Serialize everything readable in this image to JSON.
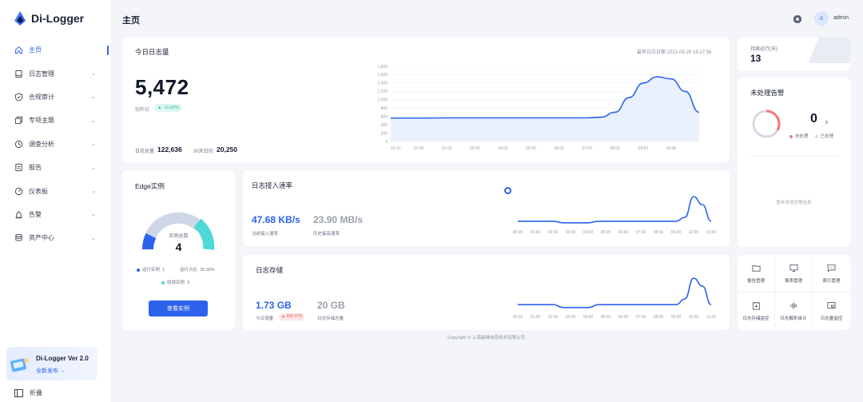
{
  "app": {
    "name": "Di-Logger",
    "page_title": "主页",
    "user": "admin",
    "avatar_letter": "A"
  },
  "sidebar": {
    "items": [
      {
        "label": "主页",
        "icon": "home-icon",
        "active": true,
        "expandable": false
      },
      {
        "label": "日志管理",
        "icon": "log-icon",
        "expandable": true
      },
      {
        "label": "合规审计",
        "icon": "shield-icon",
        "expandable": true
      },
      {
        "label": "专项主题",
        "icon": "topic-icon",
        "expandable": true
      },
      {
        "label": "调查分析",
        "icon": "analysis-icon",
        "expandable": true
      },
      {
        "label": "报告",
        "icon": "report-icon",
        "expandable": true
      },
      {
        "label": "仪表板",
        "icon": "dashboard-icon",
        "expandable": true
      },
      {
        "label": "告警",
        "icon": "alarm-icon",
        "expandable": true
      },
      {
        "label": "资产中心",
        "icon": "database-icon",
        "expandable": true
      }
    ],
    "promo": {
      "version": "Di-Logger Ver 2.0",
      "link": "全新发布 →"
    },
    "collapse": "折叠"
  },
  "today_logs": {
    "title": "今日日志量",
    "updated": "最早日志日期 2021-09-29 18:27:58",
    "value": "5,472",
    "compare_label": "较昨日",
    "compare_change": "▲ -11.62%",
    "total_label": "日志总量",
    "total_value": "122,636",
    "avg_label": "30天日均",
    "avg_value": "20,250"
  },
  "uptime": {
    "label": "持续运行(天)",
    "value": "13"
  },
  "alarms": {
    "title": "未处理告警",
    "count": "0",
    "unit": "条",
    "legend": [
      "未处理",
      "已处理"
    ],
    "empty": "暂未发现告警信息",
    "colors": {
      "unprocessed": "#ef7b7b",
      "processed": "#d5d9e2"
    }
  },
  "edge": {
    "title": "Edge实例",
    "gauge_label": "实例总数",
    "gauge_value": "4",
    "running_label": "运行实例",
    "running_value": "1",
    "ratio_label": "运行占比",
    "ratio_value": "25.00%",
    "pending_label": "收敛实例",
    "pending_value": "3",
    "button": "查看实例",
    "colors": {
      "running": "#2d62ed",
      "pending": "#4fd9d6",
      "rest": "#cfd6e6"
    }
  },
  "rate": {
    "title": "日志接入速率",
    "current_value": "47.68 KB/s",
    "current_label": "当前接入速率",
    "peak_value": "23.90 MB/s",
    "peak_label": "历史最高速率"
  },
  "storage": {
    "title": "日志存储",
    "today_value": "1.73 GB",
    "today_label": "今日增量",
    "today_change": "▲ 499.37%",
    "total_value": "20 GB",
    "total_label": "日志存储总量"
  },
  "quick_links": [
    {
      "label": "报告管理",
      "icon": "folder-icon"
    },
    {
      "label": "报表管理",
      "icon": "monitor-icon"
    },
    {
      "label": "索引管理",
      "icon": "message-icon"
    },
    {
      "label": "日志存储监控",
      "icon": "storage-monitor-icon"
    },
    {
      "label": "日志解析审计",
      "icon": "waveform-icon"
    },
    {
      "label": "日志量监控",
      "icon": "volume-monitor-icon"
    }
  ],
  "footer": "Copyright © 上海晨维信息技术有限公司",
  "chart_data": [
    {
      "type": "area",
      "name": "today_logs",
      "y_ticks": [
        "1,800",
        "1,600",
        "1,400",
        "1,200",
        "1,000",
        "800",
        "600",
        "400",
        "200",
        "0"
      ],
      "x_ticks": [
        "10-11",
        "01:00",
        "02:00",
        "03:00",
        "04:00",
        "05:00",
        "06:00",
        "07:00",
        "08:00",
        "09:00",
        "10:00"
      ],
      "ylim": [
        0,
        1800
      ],
      "x": [
        0,
        1,
        2,
        3,
        4,
        5,
        6,
        7,
        7.5,
        8,
        8.5,
        9,
        9.5,
        10,
        10.5,
        11
      ],
      "values": [
        560,
        560,
        565,
        565,
        565,
        565,
        565,
        565,
        580,
        700,
        1050,
        1400,
        1550,
        1500,
        1200,
        700
      ],
      "color": "#2d62ed"
    },
    {
      "type": "line",
      "name": "ingest_rate",
      "x_ticks": [
        "00:00",
        "01:00",
        "02:00",
        "03:00",
        "04:00",
        "05:00",
        "06:00",
        "07:00",
        "08:00",
        "09:00",
        "10:00",
        "11:00"
      ],
      "x": [
        0,
        1,
        2,
        2.6,
        3,
        4,
        4.6,
        5,
        6,
        7,
        8,
        9,
        9.5,
        10,
        10.5,
        11
      ],
      "values": [
        8,
        8,
        8,
        3,
        3,
        3,
        8,
        8,
        8,
        8,
        8,
        8,
        20,
        85,
        60,
        8
      ],
      "ylim": [
        0,
        100
      ],
      "color": "#2d62ed"
    },
    {
      "type": "line",
      "name": "storage",
      "x_ticks": [
        "00:00",
        "01:00",
        "02:00",
        "03:00",
        "04:00",
        "05:00",
        "06:00",
        "07:00",
        "08:00",
        "09:00",
        "10:00",
        "11:00"
      ],
      "x": [
        0,
        1,
        2,
        2.6,
        3,
        4,
        4.6,
        5,
        6,
        7,
        8,
        9,
        9.5,
        10,
        10.5,
        11
      ],
      "values": [
        12,
        12,
        12,
        3,
        3,
        3,
        12,
        12,
        12,
        12,
        12,
        12,
        30,
        95,
        70,
        12
      ],
      "ylim": [
        0,
        100
      ],
      "color": "#2d62ed"
    }
  ]
}
